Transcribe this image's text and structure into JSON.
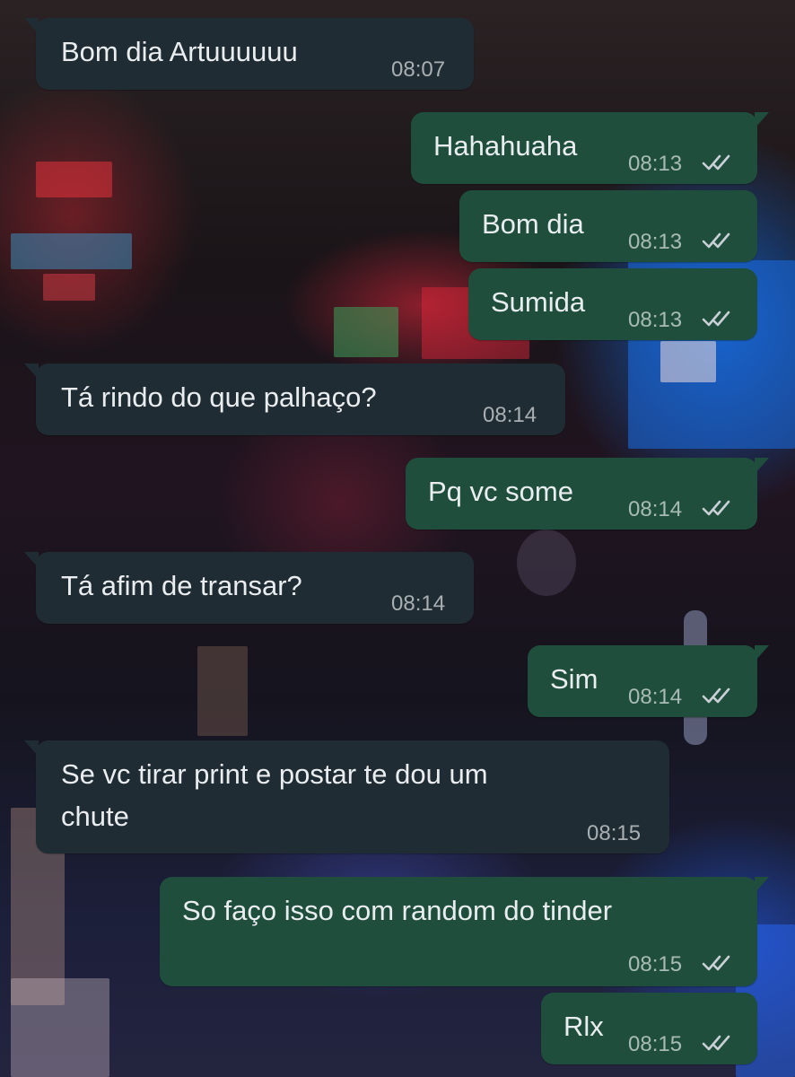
{
  "chat": {
    "messages": [
      {
        "direction": "incoming",
        "text": "Bom dia Artuuuuuu",
        "time": "08:07"
      },
      {
        "direction": "outgoing",
        "text": "Hahahuaha",
        "time": "08:13",
        "status": "double-check-icon"
      },
      {
        "direction": "outgoing",
        "text": "Bom dia",
        "time": "08:13",
        "status": "double-check-icon"
      },
      {
        "direction": "outgoing",
        "text": "Sumida",
        "time": "08:13",
        "status": "double-check-icon"
      },
      {
        "direction": "incoming",
        "text": "Tá rindo do que palhaço?",
        "time": "08:14"
      },
      {
        "direction": "outgoing",
        "text": "Pq vc some",
        "time": "08:14",
        "status": "double-check-icon"
      },
      {
        "direction": "incoming",
        "text": "Tá afim de transar?",
        "time": "08:14"
      },
      {
        "direction": "outgoing",
        "text": "Sim",
        "time": "08:14",
        "status": "double-check-icon"
      },
      {
        "direction": "incoming",
        "text_line1": "Se vc tirar print e postar te dou um",
        "text_line2": "chute",
        "time": "08:15"
      },
      {
        "direction": "outgoing",
        "text": "So faço isso com random do tinder",
        "time": "08:15",
        "status": "double-check-icon"
      },
      {
        "direction": "outgoing",
        "text": "Rlx",
        "time": "08:15",
        "status": "double-check-icon"
      }
    ]
  },
  "colors": {
    "incoming_bubble": "#202c33",
    "outgoing_bubble": "#1f4f3c",
    "text": "#e9edef",
    "meta_text": "#aab3b8"
  }
}
